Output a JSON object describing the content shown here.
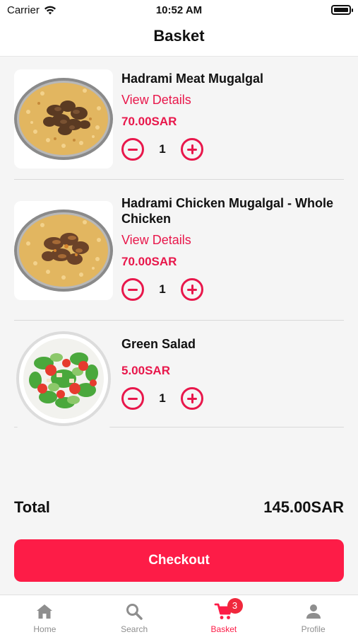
{
  "status_bar": {
    "carrier": "Carrier",
    "time": "10:52 AM"
  },
  "header": {
    "title": "Basket"
  },
  "colors": {
    "accent": "#fd1c47",
    "text": "#111111",
    "muted": "#8e8e8e"
  },
  "items": [
    {
      "name": "Hadrami Meat Mugalgal",
      "details_label": "View Details",
      "price": "70.00SAR",
      "quantity": "1",
      "image": "meat-mugalgal-plate"
    },
    {
      "name": "Hadrami Chicken Mugalgal - Whole Chicken",
      "details_label": "View Details",
      "price": "70.00SAR",
      "quantity": "1",
      "image": "chicken-mugalgal-plate"
    },
    {
      "name": "Green Salad",
      "price": "5.00SAR",
      "quantity": "1",
      "image": "green-salad-bowl"
    }
  ],
  "summary": {
    "total_label": "Total",
    "total_value": "145.00SAR"
  },
  "checkout_label": "Checkout",
  "tab_bar": {
    "tabs": [
      {
        "label": "Home",
        "icon": "home-icon"
      },
      {
        "label": "Search",
        "icon": "search-icon"
      },
      {
        "label": "Basket",
        "icon": "cart-icon",
        "badge": "3",
        "active": true
      },
      {
        "label": "Profile",
        "icon": "person-icon"
      }
    ]
  }
}
